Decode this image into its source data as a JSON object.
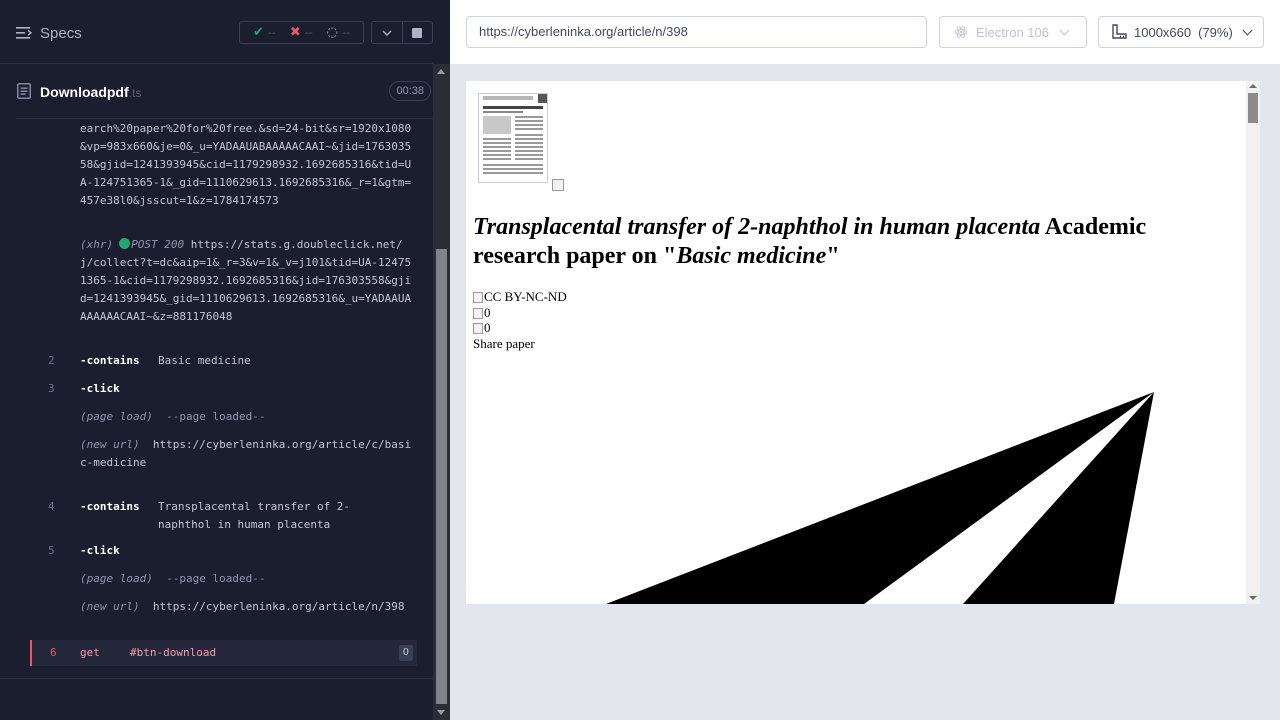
{
  "reporter": {
    "specs_label": "Specs",
    "stats": {
      "passed": "--",
      "failed": "--",
      "pending": "--"
    },
    "icons": {
      "specs": "menu-icon",
      "passed": "check-icon",
      "failed": "x-icon",
      "pending": "spinner-icon",
      "expand": "chevron-down-icon",
      "stop": "stop-icon"
    },
    "spec_file": {
      "name": "Downloadpdf",
      "ext": ".ts",
      "duration": "00:38"
    },
    "log": {
      "url_fragment": "earch%20paper%20for%20free.&sd=24-bit&sr=1920x1080&vp=983x660&je=0&_u=YADAAUABAAAAACAAI~&jid=176303558&gjid=1241393945&cid=1179298932.1692685316&tid=UA-124751365-1&_gid=1110629613.1692685316&_r=1&gtm=457e38l0&jsscut=1&z=1784174573",
      "xhr_tag": "(xhr)",
      "xhr_method": "POST 200",
      "xhr_url": "https://stats.g.doubleclick.net/j/collect?t=dc&aip=1&_r=3&v=1&_v=j101&tid=UA-124751365-1&cid=1179298932.1692685316&jid=176303558&gjid=1241393945&_gid=1110629613.1692685316&_u=YADAAUAAAAAAACAAI~&z=881176048",
      "commands": [
        {
          "num": "2",
          "name": "-contains",
          "message": "Basic medicine"
        },
        {
          "num": "3",
          "name": "-click",
          "message": ""
        },
        {
          "num": "4",
          "name": "-contains",
          "message": "Transplacental transfer of 2-naphthol in human placenta"
        },
        {
          "num": "5",
          "name": "-click",
          "message": ""
        }
      ],
      "page_load_tag": "(page load)",
      "page_load_msg": "--page loaded--",
      "new_url_tag": "(new url)",
      "new_url_1": "https://cyberleninka.org/article/c/basic-medicine",
      "new_url_2": "https://cyberleninka.org/article/n/398",
      "failed_command": {
        "num": "6",
        "name": "get",
        "message": "#btn-download",
        "count": "0"
      }
    }
  },
  "aut": {
    "url": "https://cyberleninka.org/article/n/398",
    "browser": "Electron 106",
    "viewport": "1000x660",
    "scale": "(79%)",
    "icons": {
      "browser": "electron-icon",
      "viewport": "ruler-icon"
    },
    "page": {
      "title_italic": "Transplacental transfer of 2-naphthol in human placenta",
      "title_mid": "Academic research paper on \"",
      "title_topic": "Basic medicine",
      "title_end": "\"",
      "license_alt": "CC BY-NC-ND",
      "views_alt": "0",
      "downloads_alt": "0",
      "share": "Share paper"
    }
  }
}
